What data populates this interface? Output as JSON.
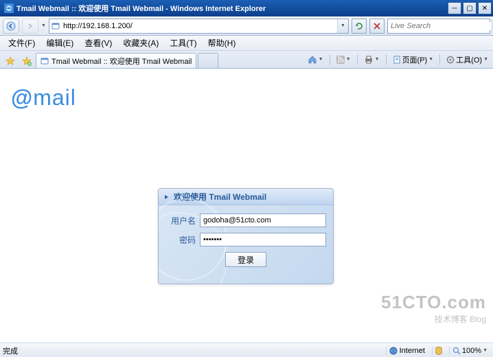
{
  "window": {
    "title": "Tmail Webmail :: 欢迎使用 Tmail Webmail - Windows Internet Explorer"
  },
  "address_bar": {
    "url": "http://192.168.1.200/"
  },
  "search": {
    "placeholder": "Live Search"
  },
  "menu": {
    "file": "文件(F)",
    "edit": "编辑(E)",
    "view": "查看(V)",
    "favorites": "收藏夹(A)",
    "tools": "工具(T)",
    "help": "帮助(H)"
  },
  "tab": {
    "title": "Tmail Webmail :: 欢迎使用 Tmail Webmail"
  },
  "toolbar": {
    "page": "页面(P)",
    "tools": "工具(O)"
  },
  "logo": {
    "at": "@",
    "text": "mail"
  },
  "login": {
    "title": "欢迎使用  Tmail Webmail",
    "username_label": "用户名",
    "username_value": "godoha@51cto.com",
    "password_label": "密码",
    "password_value": "•••••••",
    "submit": "登录"
  },
  "status": {
    "left": "完成",
    "zone": "Internet",
    "zoom": "100%"
  },
  "watermark": {
    "main": "51CTO.com",
    "sub": "技术博客    Blog"
  }
}
